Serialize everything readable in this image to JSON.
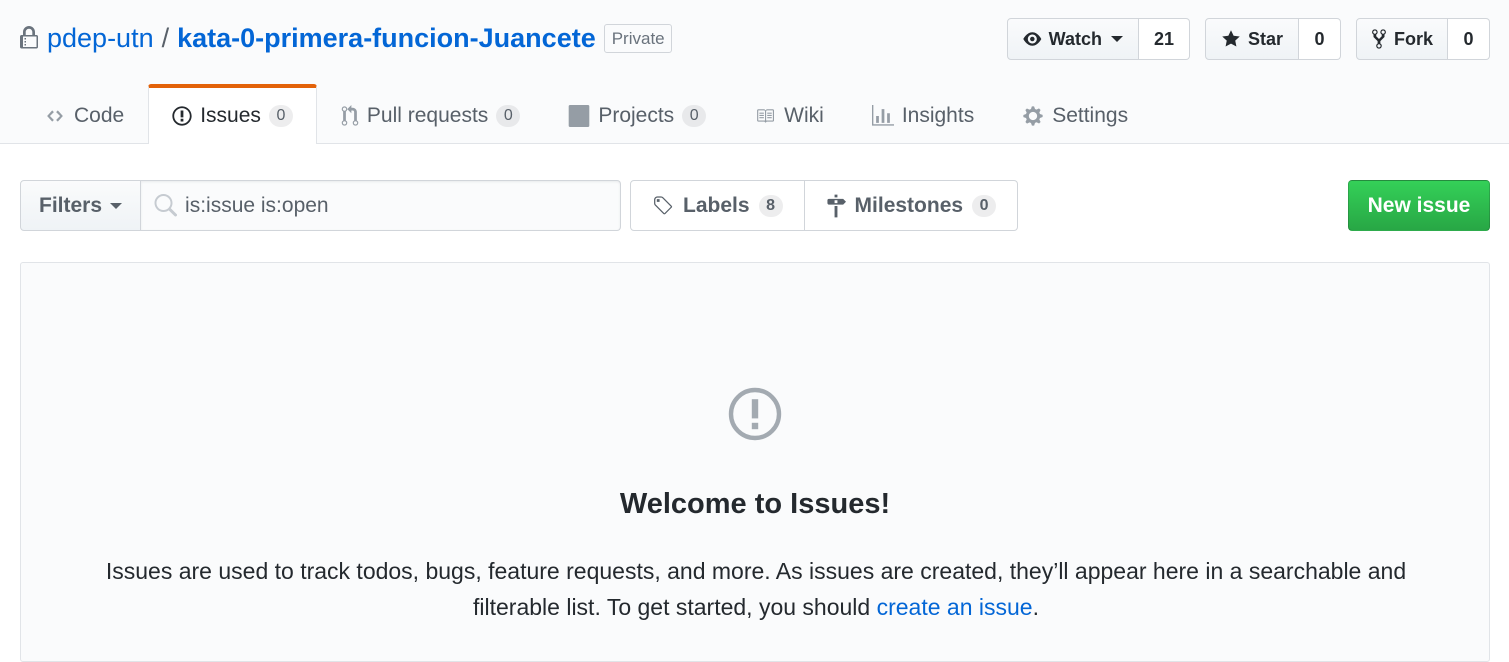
{
  "repo": {
    "owner": "pdep-utn",
    "separator": "/",
    "name": "kata-0-primera-funcion-Juancete",
    "visibility": "Private"
  },
  "actions": {
    "watch": {
      "label": "Watch",
      "count": "21"
    },
    "star": {
      "label": "Star",
      "count": "0"
    },
    "fork": {
      "label": "Fork",
      "count": "0"
    }
  },
  "tabs": [
    {
      "label": "Code",
      "icon": "code-icon"
    },
    {
      "label": "Issues",
      "count": "0",
      "icon": "issue-opened-icon",
      "selected": true
    },
    {
      "label": "Pull requests",
      "count": "0",
      "icon": "git-pull-request-icon"
    },
    {
      "label": "Projects",
      "count": "0",
      "icon": "project-icon"
    },
    {
      "label": "Wiki",
      "icon": "book-icon"
    },
    {
      "label": "Insights",
      "icon": "graph-icon"
    },
    {
      "label": "Settings",
      "icon": "gear-icon"
    }
  ],
  "filters": {
    "button_label": "Filters",
    "search_value": "is:issue is:open"
  },
  "labels": {
    "label": "Labels",
    "count": "8"
  },
  "milestones": {
    "label": "Milestones",
    "count": "0"
  },
  "new_issue_label": "New issue",
  "blankslate": {
    "title": "Welcome to Issues!",
    "text_before": "Issues are used to track todos, bugs, feature requests, and more. As issues are created, they’ll appear here in a searchable and filterable list. To get started, you should ",
    "link": "create an issue",
    "text_after": "."
  },
  "colors": {
    "link": "#0366d6",
    "tab_accent": "#e36209",
    "primary_button": "#28a745"
  }
}
